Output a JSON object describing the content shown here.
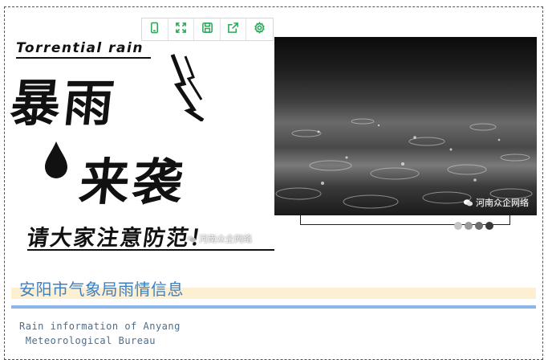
{
  "toolbar": {
    "items": [
      {
        "icon": "phone-preview-icon"
      },
      {
        "icon": "fullscreen-icon"
      },
      {
        "icon": "save-icon"
      },
      {
        "icon": "share-icon"
      },
      {
        "icon": "settings-icon"
      }
    ],
    "accent": "#2fa85c"
  },
  "poster": {
    "english_title": "Torrential rain",
    "headline_1": "暴雨",
    "headline_2": "来袭",
    "warning": "请大家注意防范！",
    "watermark": "河南众企网络"
  },
  "photo": {
    "watermark": "河南众企网络"
  },
  "carousel": {
    "dot_colors": [
      "#c4c4c4",
      "#9a9a9a",
      "#6e6e6e",
      "#3a3a3a"
    ]
  },
  "section": {
    "title": "安阳市气象局雨情信息",
    "subtitle_line1": "Rain information of Anyang",
    "subtitle_line2": " Meteorological Bureau",
    "title_color": "#3d7fc0",
    "highlight_color": "#fdefd2",
    "rule_color": "#8bb6ea"
  }
}
